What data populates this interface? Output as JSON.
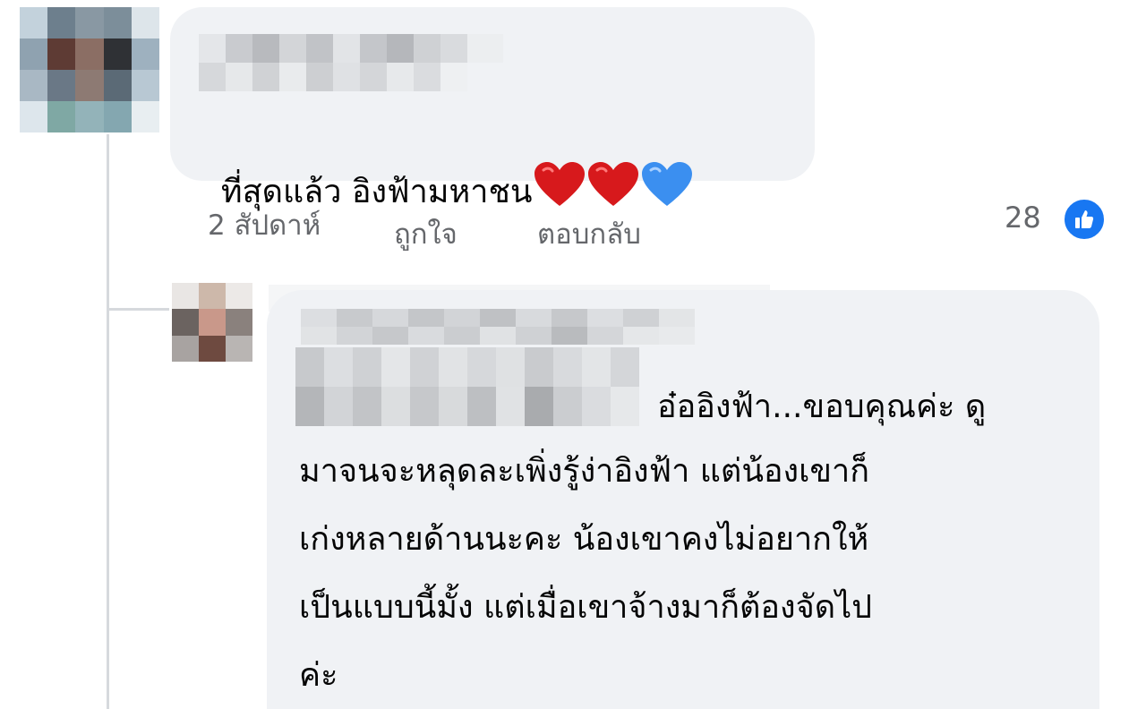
{
  "comment1": {
    "author": "",
    "text": "ที่สุดแล้ว อิงฟ้ามหาชน",
    "emoji_icons": [
      "red-heart-icon",
      "red-heart-icon",
      "blue-heart-icon"
    ],
    "timestamp": "2 สัปดาห์",
    "like_label": "ถูกใจ",
    "reply_label": "ตอบกลับ",
    "reaction_count": "28",
    "reaction_icon": "thumbs-up-icon"
  },
  "reply1": {
    "author": "",
    "line1": "อ๋ออิงฟ้า...ขอบคุณค่ะ ดู",
    "line2": "มาจนจะหลุดละเพิ่งรู้ง่าอิงฟ้า แต่น้องเขาก็",
    "line3": "เก่งหลายด้านนะคะ น้องเขาคงไม่อยากให้",
    "line4": "เป็นแบบนี้มั้ง แต่เมื่อเขาจ้างมาก็ต้องจัดไป",
    "line5": "ค่ะ"
  },
  "colors": {
    "bubble": "#f0f2f5",
    "text": "#050505",
    "meta": "#65676b",
    "like_blue": "#1877f2",
    "heart_red": "#d7191c",
    "heart_blue": "#3b8ff0"
  }
}
